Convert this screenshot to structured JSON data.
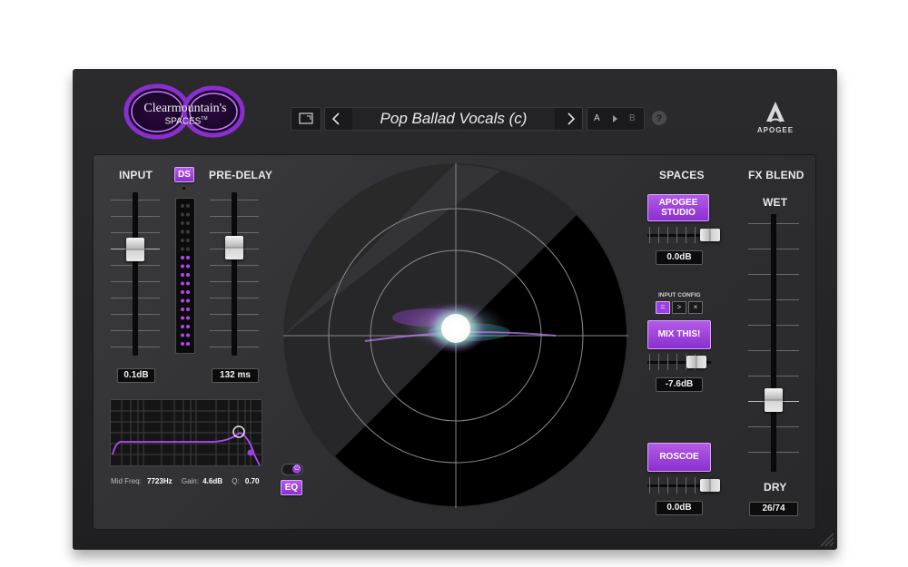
{
  "brand": {
    "logo_text_main": "Clearmountain's",
    "logo_text_sub": "SPACES",
    "logo_tm": "TM",
    "company": "APOGEE"
  },
  "toolbar": {
    "preset_name": "Pop Ballad Vocals (c)",
    "ab_a": "A",
    "ab_b": "B",
    "help": "?"
  },
  "input": {
    "label": "INPUT",
    "value": "0.1dB",
    "level": 0.55
  },
  "ds": {
    "label": "DS"
  },
  "predelay": {
    "label": "PRE-DELAY",
    "value": "132 ms",
    "level": 0.62
  },
  "eq": {
    "mid_freq_label": "Mid Freq:",
    "mid_freq_value": "7723Hz",
    "gain_label": "Gain:",
    "gain_value": "4.6dB",
    "q_label": "Q:",
    "q_value": "0.70",
    "button": "EQ"
  },
  "spaces": {
    "label": "SPACES",
    "items": [
      {
        "name": "APOGEE\nSTUDIO",
        "value": "0.0dB"
      },
      {
        "name": "MIX THIS!",
        "value": "-7.6dB"
      },
      {
        "name": "ROSCOE",
        "value": "0.0dB"
      }
    ],
    "input_config_label": "INPUT CONFIG"
  },
  "fx_blend": {
    "label": "FX BLEND",
    "wet": "WET",
    "dry": "DRY",
    "value": "26/74"
  },
  "colors": {
    "accent": "#9b3fe0",
    "accent_light": "#c77dff",
    "meter_on": "#b445f0"
  }
}
